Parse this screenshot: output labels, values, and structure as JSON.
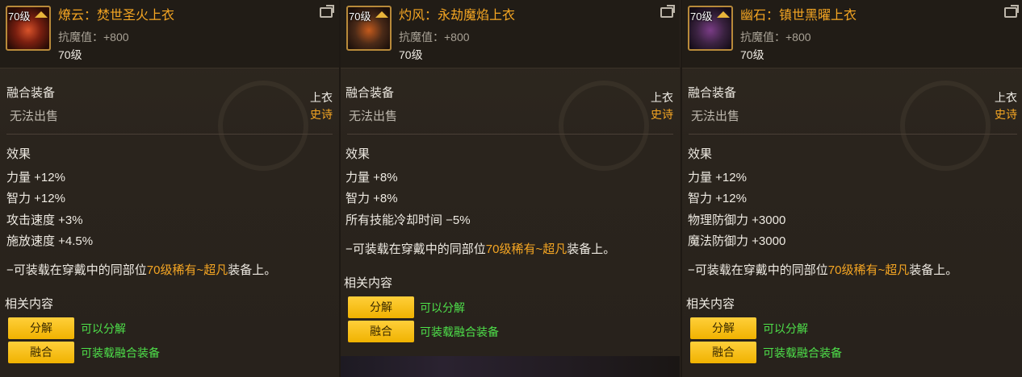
{
  "panels": [
    {
      "level_badge": "70级",
      "title": "燎云：焚世圣火上衣",
      "resist": "抗魔值：+800",
      "level": "70级",
      "fusion_header": "融合装备",
      "fusion_sub": "无法出售",
      "slot": "上衣",
      "grade": "史诗",
      "effect_header": "效果",
      "stats": [
        "力量 +12%",
        "智力 +12%",
        "攻击速度 +3%",
        "施放速度 +4.5%"
      ],
      "note_pre": "−可装载在穿戴中的同部位",
      "note_hl": "70级稀有~超凡",
      "note_post": "装备上。",
      "related_header": "相关内容",
      "btn1": "分解",
      "btn1_label": "可以分解",
      "btn2": "融合",
      "btn2_label": "可装载融合装备"
    },
    {
      "level_badge": "70级",
      "title": "灼风：永劫魔焰上衣",
      "resist": "抗魔值：+800",
      "level": "70级",
      "fusion_header": "融合装备",
      "fusion_sub": "无法出售",
      "slot": "上衣",
      "grade": "史诗",
      "effect_header": "效果",
      "stats": [
        "力量 +8%",
        "智力 +8%",
        "所有技能冷却时间 −5%"
      ],
      "note_pre": "−可装载在穿戴中的同部位",
      "note_hl": "70级稀有~超凡",
      "note_post": "装备上。",
      "related_header": "相关内容",
      "btn1": "分解",
      "btn1_label": "可以分解",
      "btn2": "融合",
      "btn2_label": "可装载融合装备"
    },
    {
      "level_badge": "70级",
      "title": "幽石：镇世黑曜上衣",
      "resist": "抗魔值：+800",
      "level": "70级",
      "fusion_header": "融合装备",
      "fusion_sub": "无法出售",
      "slot": "上衣",
      "grade": "史诗",
      "effect_header": "效果",
      "stats": [
        "力量 +12%",
        "智力 +12%",
        "物理防御力 +3000",
        "魔法防御力 +3000"
      ],
      "note_pre": "−可装载在穿戴中的同部位",
      "note_hl": "70级稀有~超凡",
      "note_post": "装备上。",
      "related_header": "相关内容",
      "btn1": "分解",
      "btn1_label": "可以分解",
      "btn2": "融合",
      "btn2_label": "可装载融合装备"
    }
  ],
  "colors": {
    "title": "#f5a623",
    "grade": "#f5a623",
    "button": "#ffc21a",
    "ok_text": "#4ee04a"
  },
  "icons": [
    "item-icon",
    "crown-icon",
    "share-icon"
  ]
}
